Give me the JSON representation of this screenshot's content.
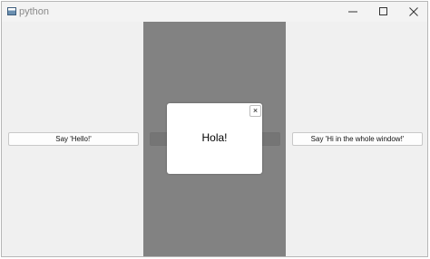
{
  "window": {
    "title": "python"
  },
  "buttons": {
    "hello_label": "Say 'Hello!'",
    "center_label": "",
    "whole_window_label": "Say 'Hi in the whole window!'"
  },
  "popup": {
    "message": "Hola!",
    "close_glyph": "×"
  },
  "colors": {
    "overlay": "#6e6e6e",
    "window_background": "#f0f0f0"
  }
}
